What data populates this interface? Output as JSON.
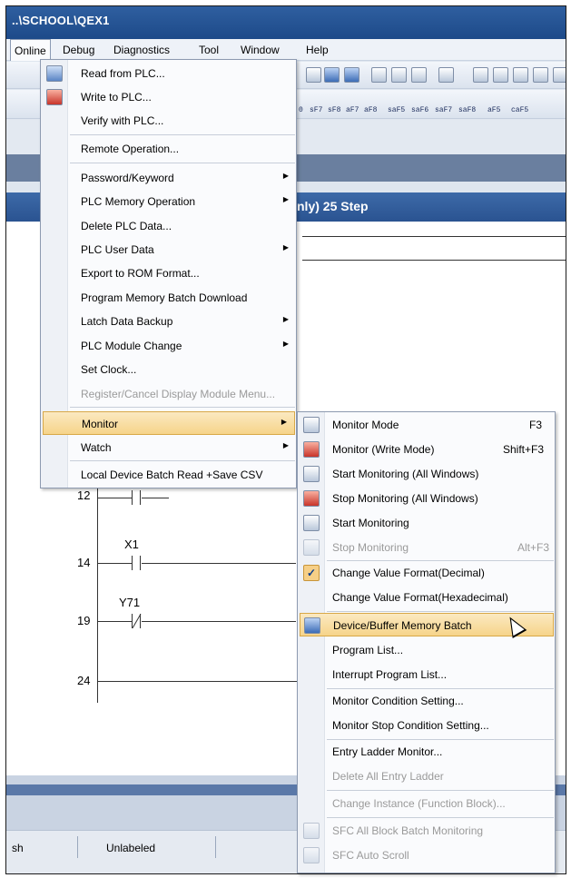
{
  "window": {
    "title": "..\\SCHOOL\\QEX1"
  },
  "menubar": [
    "Online",
    "Debug",
    "Diagnostics",
    "Tool",
    "Window",
    "Help"
  ],
  "toolbar_labels": [
    "sF7",
    "sF8",
    "aF7",
    "aF8",
    "saF5",
    "saF6",
    "saF7",
    "saF8",
    "aF5",
    "caF5",
    "0"
  ],
  "document": {
    "title_fragment": "nly) 25 Step"
  },
  "online_menu": [
    {
      "label": "Read from PLC...",
      "icon": "read-from-plc-icon"
    },
    {
      "label": "Write to PLC...",
      "icon": "write-to-plc-icon"
    },
    {
      "label": "Verify with PLC..."
    },
    {
      "label": "Remote Operation..."
    },
    {
      "label": "Password/Keyword",
      "submenu": true
    },
    {
      "label": "PLC Memory Operation",
      "submenu": true
    },
    {
      "label": "Delete PLC Data..."
    },
    {
      "label": "PLC User Data",
      "submenu": true
    },
    {
      "label": "Export to ROM Format..."
    },
    {
      "label": "Program Memory Batch Download"
    },
    {
      "label": "Latch Data Backup",
      "submenu": true
    },
    {
      "label": "PLC Module Change",
      "submenu": true
    },
    {
      "label": "Set Clock..."
    },
    {
      "label": "Register/Cancel Display Module Menu...",
      "disabled": true
    },
    {
      "label": "Monitor",
      "submenu": true,
      "highlighted": true
    },
    {
      "label": "Watch",
      "submenu": true
    },
    {
      "label": "Local Device Batch Read +Save CSV"
    }
  ],
  "monitor_submenu": [
    {
      "label": "Monitor Mode",
      "shortcut": "F3",
      "icon": "monitor-mode-icon"
    },
    {
      "label": "Monitor (Write Mode)",
      "shortcut": "Shift+F3",
      "icon": "monitor-write-mode-icon"
    },
    {
      "label": "Start Monitoring (All Windows)",
      "icon": "start-monitoring-all-icon"
    },
    {
      "label": "Stop Monitoring (All Windows)",
      "icon": "stop-monitoring-all-icon"
    },
    {
      "label": "Start Monitoring",
      "icon": "start-monitoring-icon"
    },
    {
      "label": "Stop Monitoring",
      "shortcut": "Alt+F3",
      "disabled": true,
      "icon": "stop-monitoring-icon"
    },
    {
      "label": "Change Value Format(Decimal)",
      "checked": true
    },
    {
      "label": "Change Value Format(Hexadecimal)"
    },
    {
      "label": "Device/Buffer Memory Batch",
      "highlighted": true,
      "icon": "device-buffer-memory-icon"
    },
    {
      "label": "Program List..."
    },
    {
      "label": "Interrupt Program List..."
    },
    {
      "label": "Monitor Condition Setting..."
    },
    {
      "label": "Monitor Stop Condition Setting..."
    },
    {
      "label": "Entry Ladder Monitor..."
    },
    {
      "label": "Delete All Entry Ladder",
      "disabled": true
    },
    {
      "label": "Change Instance (Function Block)...",
      "disabled": true
    },
    {
      "label": "SFC All Block Batch Monitoring",
      "disabled": true,
      "icon": "sfc-batch-monitor-icon"
    },
    {
      "label": "SFC Auto Scroll",
      "disabled": true,
      "icon": "sfc-auto-scroll-icon"
    }
  ],
  "ladder": {
    "rungs": [
      {
        "step": "12",
        "device": ""
      },
      {
        "step": "14",
        "device": "X1"
      },
      {
        "step": "19",
        "device": "Y71"
      },
      {
        "step": "24",
        "device": ""
      }
    ]
  },
  "status": {
    "left": "sh",
    "label": "Unlabeled"
  }
}
